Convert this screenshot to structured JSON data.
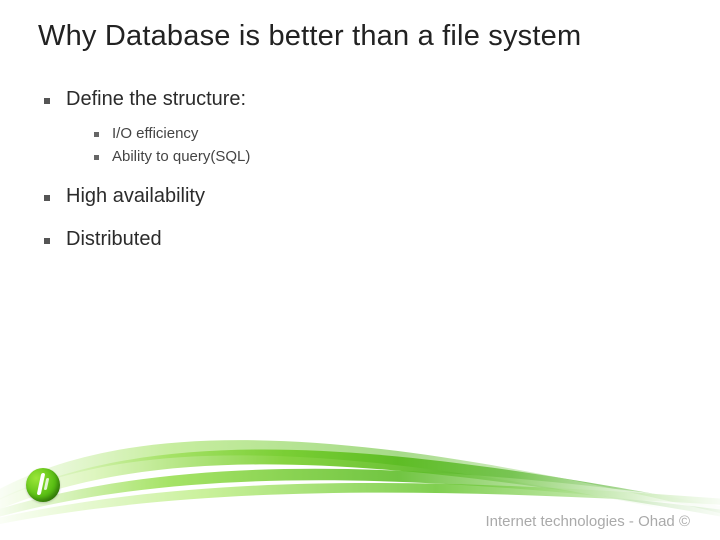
{
  "title": "Why Database is better than a file system",
  "bullets": {
    "item0": "Define the structure:",
    "item0_sub0": "I/O efficiency",
    "item0_sub1": "Ability to query(SQL)",
    "item1": "High availability",
    "item2": "Distributed"
  },
  "footer": "Internet  technologies - Ohad ©"
}
